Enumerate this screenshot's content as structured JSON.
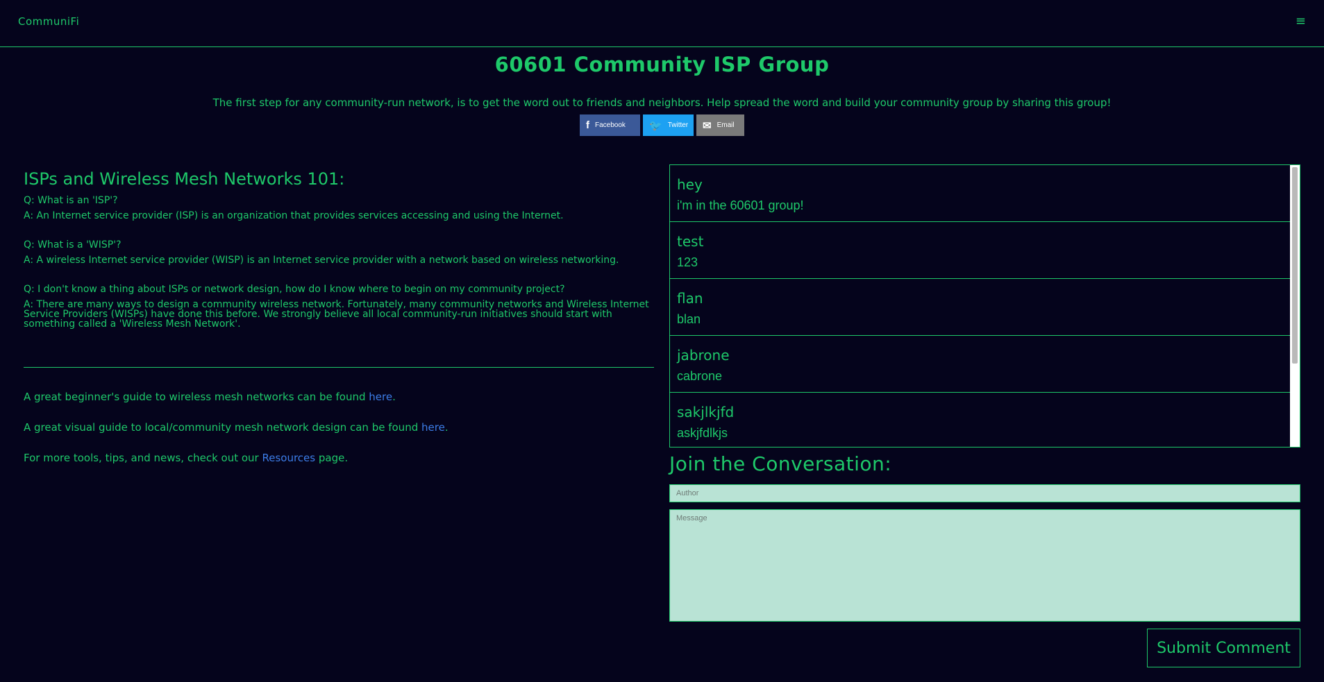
{
  "nav": {
    "brand": "CommuniFi",
    "menu_icon": "≡"
  },
  "page": {
    "title": "60601 Community ISP Group",
    "intro": "The first step for any community-run network, is to get the word out to friends and neighbors. Help spread the word and build your community group by sharing this group!"
  },
  "share": {
    "facebook": {
      "label": "Facebook",
      "icon": "f",
      "color": "#3b5998"
    },
    "twitter": {
      "label": "Twitter",
      "icon": "🐦",
      "color": "#1da1f2"
    },
    "email": {
      "label": "Email",
      "icon": "✉",
      "color": "#7a7a7a"
    }
  },
  "faq": {
    "heading": "ISPs and Wireless Mesh Networks 101:",
    "items": [
      {
        "q": "Q: What is an 'ISP'?",
        "a": "A: An Internet service provider (ISP) is an organization that provides services accessing and using the Internet."
      },
      {
        "q": "Q: What is a 'WISP'?",
        "a": "A: A wireless Internet service provider (WISP) is an Internet service provider with a network based on wireless networking."
      },
      {
        "q": "Q: I don't know a thing about ISPs or network design, how do I know where to begin on my community project?",
        "a": "A: There are many ways to design a community wireless network. Fortunately, many community networks and Wireless Internet Service Providers (WISPs) have done this before. We strongly believe all local community-run initiatives should start with something called a 'Wireless Mesh Network'."
      }
    ]
  },
  "resources": {
    "guide1_text": "A great beginner's guide to wireless mesh networks can be found ",
    "guide1_link": "here",
    "guide2_text": "A great visual guide to local/community mesh network design can be found ",
    "guide2_link": "here",
    "more_text": "For more tools, tips, and news, check out our ",
    "more_link": "Resources",
    "more_suffix": " page.",
    "period": "."
  },
  "comments": [
    {
      "author": "hey",
      "message": "i'm in the 60601 group!"
    },
    {
      "author": "test",
      "message": "123"
    },
    {
      "author": "flan",
      "message": "blan"
    },
    {
      "author": "jabrone",
      "message": "cabrone"
    },
    {
      "author": "sakjlkjfd",
      "message": "askjfdlkjs"
    }
  ],
  "form": {
    "heading": "Join the Conversation:",
    "author_placeholder": "Author",
    "message_placeholder": "Message",
    "submit_label": "Submit Comment"
  },
  "colors": {
    "background": "#05041c",
    "accent": "#1ec96a",
    "link": "#3c7de8",
    "input_bg": "#b9e3d5"
  }
}
